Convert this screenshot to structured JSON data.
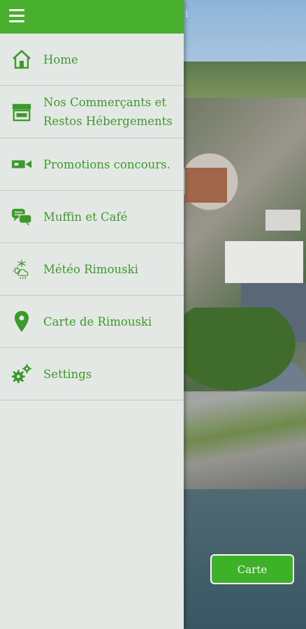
{
  "header": {
    "title_peek": "i"
  },
  "menu": {
    "items": [
      {
        "label": "Home",
        "icon": "home-icon"
      },
      {
        "label_line1": "Nos Commerçants et",
        "label_line2": "Restos Hébergements",
        "icon": "store-icon"
      },
      {
        "label": "Promotions concours.",
        "icon": "coupon-icon"
      },
      {
        "label": "Muffin et Café",
        "icon": "chat-bubbles-icon"
      },
      {
        "label": "Météo Rimouski",
        "icon": "weather-icon"
      },
      {
        "label": "Carte de Rimouski",
        "icon": "map-pin-icon"
      },
      {
        "label": "Settings",
        "icon": "gears-icon"
      }
    ]
  },
  "map_button": {
    "label": "Carte"
  },
  "colors": {
    "accent": "#48b02e",
    "text_green": "#3c9a2a",
    "drawer_bg": "#e4e8e4"
  }
}
